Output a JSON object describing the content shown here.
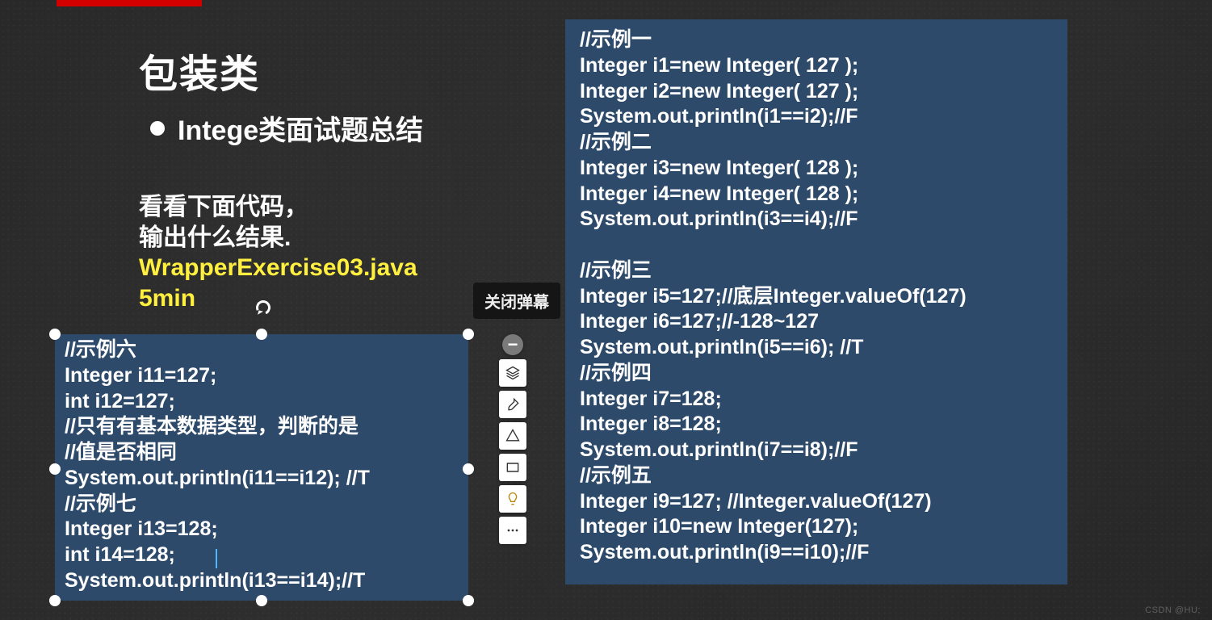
{
  "header": {
    "title": "包装类",
    "bullet": "Intege类面试题总结"
  },
  "intro": {
    "line1": "看看下面代码，",
    "line2": "输出什么结果.",
    "file": "WrapperExercise03.java",
    "time": "5min"
  },
  "code_right": "//示例一\nInteger i1=new Integer( 127 );\nInteger i2=new Integer( 127 );\nSystem.out.println(i1==i2);//F\n//示例二\nInteger i3=new Integer( 128 );\nInteger i4=new Integer( 128 );\nSystem.out.println(i3==i4);//F\n\n//示例三\nInteger i5=127;//底层Integer.valueOf(127)\nInteger i6=127;//-128~127\nSystem.out.println(i5==i6); //T\n//示例四\nInteger i7=128;\nInteger i8=128;\nSystem.out.println(i7==i8);//F\n//示例五\nInteger i9=127; //Integer.valueOf(127)\nInteger i10=new Integer(127);\nSystem.out.println(i9==i10);//F",
  "code_left": "//示例六\nInteger i11=127;\nint i12=127;\n//只有有基本数据类型，判断的是\n//值是否相同\nSystem.out.println(i11==i12); //T\n//示例七\nInteger i13=128;\nint i14=128;\nSystem.out.println(i13==i14);//T",
  "tooltip": "关闭弹幕",
  "toolbar": {
    "items": [
      "collapse",
      "layers",
      "brush",
      "shape",
      "frame",
      "idea",
      "more"
    ]
  },
  "watermark": "CSDN @HU;"
}
